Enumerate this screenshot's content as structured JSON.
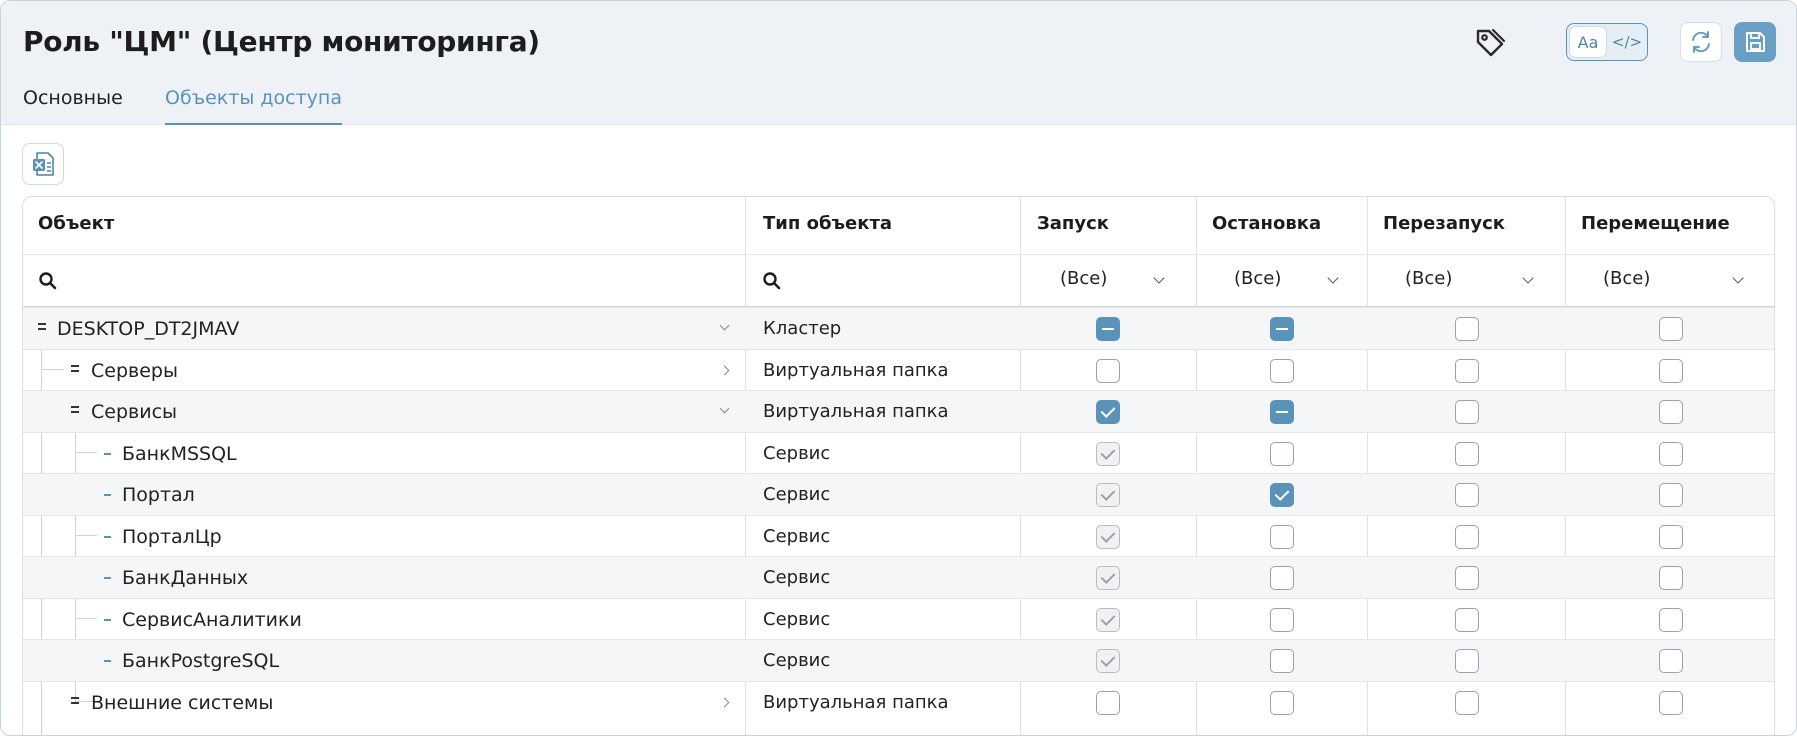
{
  "header": {
    "title": "Роль \"ЦМ\" (Центр мониторинга)",
    "tabs": [
      {
        "label": "Основные",
        "active": false
      },
      {
        "label": "Объекты доступа",
        "active": true
      }
    ],
    "mode_toggle": {
      "text_label": "Aa",
      "code_label": "</>",
      "selected": "text"
    },
    "icons": [
      "tag-icon",
      "refresh-icon",
      "save-icon",
      "excel-icon"
    ],
    "accent_color": "#5a93ba"
  },
  "grid": {
    "columns": [
      "Объект",
      "Тип объекта",
      "Запуск",
      "Остановка",
      "Перезапуск",
      "Перемещение"
    ],
    "filters": [
      "(Все)",
      "(Все)",
      "(Все)",
      "(Все)"
    ],
    "rows": [
      {
        "name": "DESKTOP_DT2JMAV",
        "type": "Кластер",
        "level": 0,
        "marker": "group",
        "expander": "expanded",
        "start": "indeterminate",
        "stop": "indeterminate",
        "restart": "unchecked",
        "move": "unchecked"
      },
      {
        "name": "Серверы",
        "type": "Виртуальная папка",
        "level": 1,
        "marker": "group",
        "expander": "collapsed",
        "start": "unchecked",
        "stop": "unchecked",
        "restart": "unchecked",
        "move": "unchecked"
      },
      {
        "name": "Сервисы",
        "type": "Виртуальная папка",
        "level": 1,
        "marker": "group",
        "expander": "expanded",
        "start": "checked",
        "stop": "indeterminate",
        "restart": "unchecked",
        "move": "unchecked"
      },
      {
        "name": "БанкMSSQL",
        "type": "Сервис",
        "level": 2,
        "marker": "item",
        "expander": "none",
        "start": "inherited",
        "stop": "unchecked",
        "restart": "unchecked",
        "move": "unchecked"
      },
      {
        "name": "Портал",
        "type": "Сервис",
        "level": 2,
        "marker": "item",
        "expander": "none",
        "start": "inherited",
        "stop": "checked",
        "restart": "unchecked",
        "move": "unchecked"
      },
      {
        "name": "ПорталЦр",
        "type": "Сервис",
        "level": 2,
        "marker": "item",
        "expander": "none",
        "start": "inherited",
        "stop": "unchecked",
        "restart": "unchecked",
        "move": "unchecked"
      },
      {
        "name": "БанкДанных",
        "type": "Сервис",
        "level": 2,
        "marker": "item",
        "expander": "none",
        "start": "inherited",
        "stop": "unchecked",
        "restart": "unchecked",
        "move": "unchecked"
      },
      {
        "name": "СервисАналитики",
        "type": "Сервис",
        "level": 2,
        "marker": "item",
        "expander": "none",
        "start": "inherited",
        "stop": "unchecked",
        "restart": "unchecked",
        "move": "unchecked"
      },
      {
        "name": "БанкPostgreSQL",
        "type": "Сервис",
        "level": 2,
        "marker": "item",
        "expander": "none",
        "start": "inherited",
        "stop": "unchecked",
        "restart": "unchecked",
        "move": "unchecked"
      },
      {
        "name": "Внешние системы",
        "type": "Виртуальная папка",
        "level": 1,
        "marker": "group",
        "expander": "collapsed",
        "start": "unchecked",
        "stop": "unchecked",
        "restart": "unchecked",
        "move": "unchecked"
      }
    ]
  }
}
